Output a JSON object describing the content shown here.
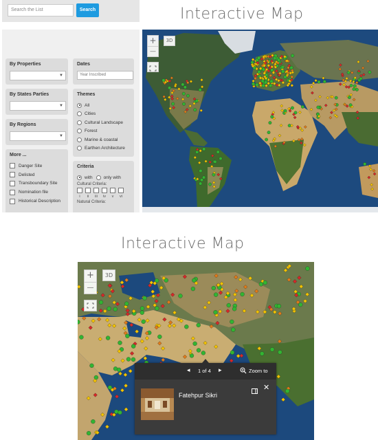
{
  "titles": {
    "top": "Interactive Map",
    "bottom": "Interactive Map"
  },
  "search": {
    "placeholder": "Search the List",
    "button": "Search"
  },
  "filters": {
    "properties_label": "By Properties",
    "states_label": "By States Parties",
    "regions_label": "By Regions",
    "more_label": "More ...",
    "more_items": [
      "Danger Site",
      "Delisted",
      "Transboundary Site",
      "Nomination file",
      "Historical Description"
    ],
    "dates_label": "Dates",
    "dates_placeholder": "Year Inscribed",
    "themes_label": "Themes",
    "themes": [
      "All",
      "Cities",
      "Cultural Landscape",
      "Forest",
      "Marine & coastal",
      "Earthen Architecture"
    ],
    "criteria_label": "Criteria",
    "criteria_with": "with",
    "criteria_only": "only with",
    "cultural_criteria": "Cultural Criteria:",
    "criteria_numerals": [
      "i",
      "ii",
      "iii",
      "iv",
      "v",
      "vi"
    ],
    "natural_criteria": "Natural Criteria:"
  },
  "map_controls": {
    "zoom_in": "+",
    "zoom_out": "—",
    "three_d": "3D",
    "fullscreen_icon": "fullscreen-icon"
  },
  "popup": {
    "pager": "1 of 4",
    "zoom_to": "Zoom to",
    "site_name": "Fatehpur Sikri"
  },
  "colors": {
    "cultural": "#f2c200",
    "natural": "#32b432",
    "mixed": "#e07b1a",
    "danger": "#d62828",
    "search_button": "#1e9be0"
  }
}
